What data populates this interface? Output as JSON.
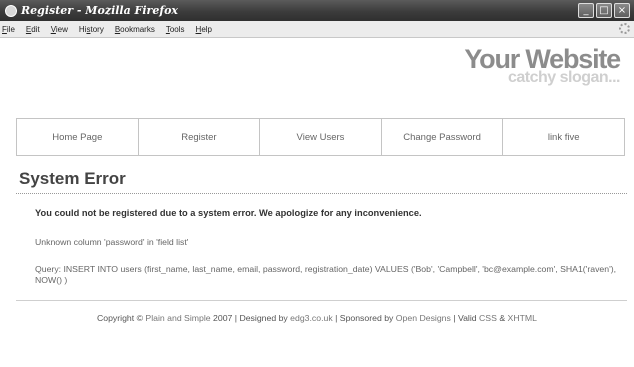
{
  "window": {
    "title": "Register - Mozilla Firefox"
  },
  "window_buttons": {
    "minimize": "_",
    "maximize": "□",
    "close": "×"
  },
  "menu": {
    "items": [
      {
        "label": "File",
        "accel": "F",
        "rest": "ile"
      },
      {
        "label": "Edit",
        "accel": "E",
        "rest": "dit"
      },
      {
        "label": "View",
        "accel": "V",
        "rest": "iew"
      },
      {
        "label": "History",
        "accel": "s",
        "pre": "Hi",
        "rest": "tory"
      },
      {
        "label": "Bookmarks",
        "accel": "B",
        "rest": "ookmarks"
      },
      {
        "label": "Tools",
        "accel": "T",
        "rest": "ools"
      },
      {
        "label": "Help",
        "accel": "H",
        "rest": "elp"
      }
    ]
  },
  "site": {
    "title": "Your Website",
    "slogan": "catchy slogan..."
  },
  "nav": {
    "items": [
      "Home Page",
      "Register",
      "View Users",
      "Change Password",
      "link five"
    ]
  },
  "content": {
    "heading": "System Error",
    "message": "You could not be registered due to a system error. We apologize for any inconvenience.",
    "error": "Unknown column 'password' in 'field list'",
    "query": "Query: INSERT INTO users (first_name, last_name, email, password, registration_date) VALUES ('Bob', 'Campbell', 'bc@example.com', SHA1('raven'), NOW() )"
  },
  "footer": {
    "copyright_prefix": "Copyright © ",
    "plain_simple": "Plain and Simple",
    "year_designed": " 2007 | Designed by ",
    "edg3": "edg3.co.uk",
    "sponsored": " | Sponsored by ",
    "open_designs": "Open Designs",
    "valid": " | Valid ",
    "css": "CSS",
    "amp": " & ",
    "xhtml": "XHTML"
  }
}
